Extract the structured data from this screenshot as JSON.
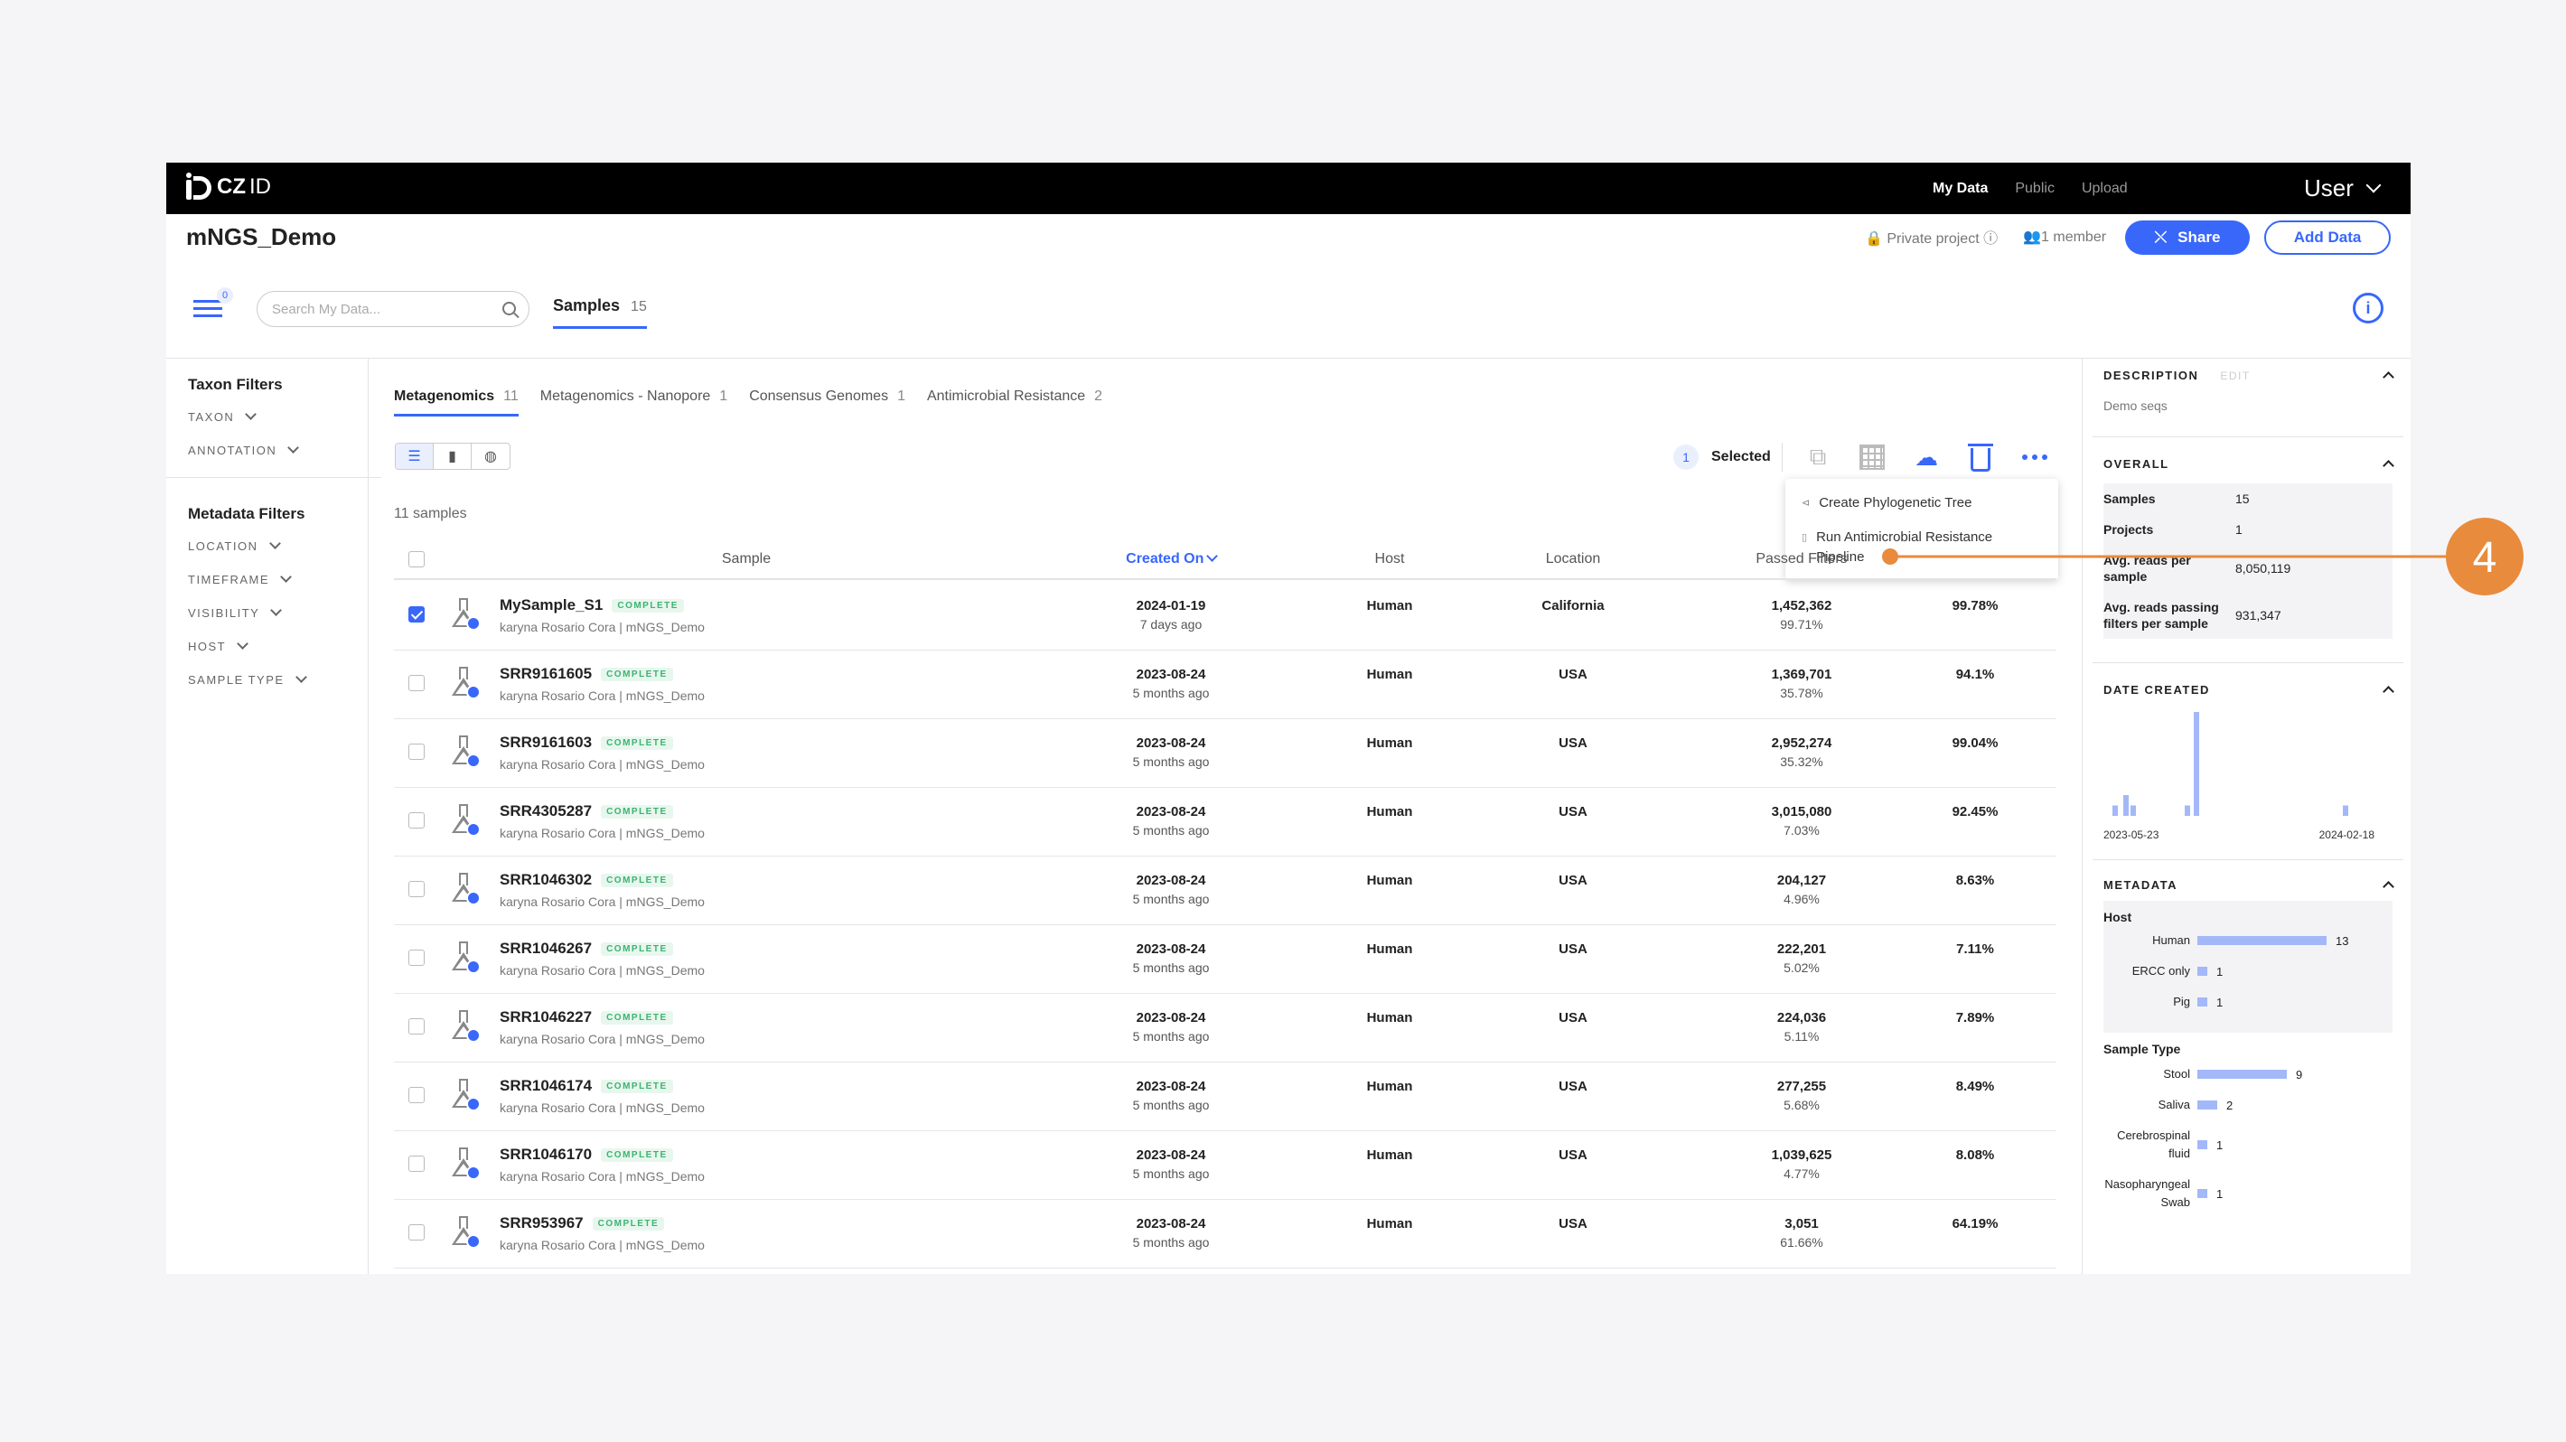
{
  "nav": {
    "brand": "CZ",
    "brand_suffix": "ID",
    "links": [
      "My Data",
      "Public",
      "Upload"
    ],
    "user": "User"
  },
  "project": {
    "title": "mNGS_Demo",
    "privacy": "Private project",
    "members": "1 member",
    "share_label": "Share",
    "add_data_label": "Add Data"
  },
  "toolbar": {
    "filter_badge": "0",
    "search_placeholder": "Search My Data...",
    "samples_tab": "Samples",
    "samples_count": "15"
  },
  "filters": {
    "taxon_title": "Taxon Filters",
    "taxon_items": [
      "TAXON",
      "ANNOTATION"
    ],
    "metadata_title": "Metadata Filters",
    "metadata_items": [
      "LOCATION",
      "TIMEFRAME",
      "VISIBILITY",
      "HOST",
      "SAMPLE TYPE"
    ]
  },
  "workflow_tabs": [
    {
      "label": "Metagenomics",
      "count": "11"
    },
    {
      "label": "Metagenomics - Nanopore",
      "count": "1"
    },
    {
      "label": "Consensus Genomes",
      "count": "1"
    },
    {
      "label": "Antimicrobial Resistance",
      "count": "2"
    }
  ],
  "selection": {
    "count": "1",
    "label": "Selected"
  },
  "dropdown": {
    "opt1": "Create Phylogenetic Tree",
    "opt2_line1": "Run Antimicrobial Resistance",
    "opt2_line2": "Pipeline"
  },
  "sample_count_text": "11 samples",
  "table": {
    "headers": [
      "Sample",
      "Created On",
      "Host",
      "Location",
      "Passed Filters"
    ],
    "status": "COMPLETE",
    "rows": [
      {
        "name": "MySample_S1",
        "sub": "karyna Rosario Cora | mNGS_Demo",
        "date": "2024-01-19",
        "ago": "7 days ago",
        "host": "Human",
        "loc": "California",
        "reads": "1,452,362",
        "pct": "99.71%",
        "last": "99.78%"
      },
      {
        "name": "SRR9161605",
        "sub": "karyna Rosario Cora | mNGS_Demo",
        "date": "2023-08-24",
        "ago": "5 months ago",
        "host": "Human",
        "loc": "USA",
        "reads": "1,369,701",
        "pct": "35.78%",
        "last": "94.1%"
      },
      {
        "name": "SRR9161603",
        "sub": "karyna Rosario Cora | mNGS_Demo",
        "date": "2023-08-24",
        "ago": "5 months ago",
        "host": "Human",
        "loc": "USA",
        "reads": "2,952,274",
        "pct": "35.32%",
        "last": "99.04%"
      },
      {
        "name": "SRR4305287",
        "sub": "karyna Rosario Cora | mNGS_Demo",
        "date": "2023-08-24",
        "ago": "5 months ago",
        "host": "Human",
        "loc": "USA",
        "reads": "3,015,080",
        "pct": "7.03%",
        "last": "92.45%"
      },
      {
        "name": "SRR1046302",
        "sub": "karyna Rosario Cora | mNGS_Demo",
        "date": "2023-08-24",
        "ago": "5 months ago",
        "host": "Human",
        "loc": "USA",
        "reads": "204,127",
        "pct": "4.96%",
        "last": "8.63%"
      },
      {
        "name": "SRR1046267",
        "sub": "karyna Rosario Cora | mNGS_Demo",
        "date": "2023-08-24",
        "ago": "5 months ago",
        "host": "Human",
        "loc": "USA",
        "reads": "222,201",
        "pct": "5.02%",
        "last": "7.11%"
      },
      {
        "name": "SRR1046227",
        "sub": "karyna Rosario Cora | mNGS_Demo",
        "date": "2023-08-24",
        "ago": "5 months ago",
        "host": "Human",
        "loc": "USA",
        "reads": "224,036",
        "pct": "5.11%",
        "last": "7.89%"
      },
      {
        "name": "SRR1046174",
        "sub": "karyna Rosario Cora | mNGS_Demo",
        "date": "2023-08-24",
        "ago": "5 months ago",
        "host": "Human",
        "loc": "USA",
        "reads": "277,255",
        "pct": "5.68%",
        "last": "8.49%"
      },
      {
        "name": "SRR1046170",
        "sub": "karyna Rosario Cora | mNGS_Demo",
        "date": "2023-08-24",
        "ago": "5 months ago",
        "host": "Human",
        "loc": "USA",
        "reads": "1,039,625",
        "pct": "4.77%",
        "last": "8.08%"
      },
      {
        "name": "SRR953967",
        "sub": "karyna Rosario Cora | mNGS_Demo",
        "date": "2023-08-24",
        "ago": "5 months ago",
        "host": "Human",
        "loc": "USA",
        "reads": "3,051",
        "pct": "61.66%",
        "last": "64.19%"
      }
    ]
  },
  "panel": {
    "description_title": "DESCRIPTION",
    "edit": "EDIT",
    "description": "Demo seqs",
    "overall_title": "OVERALL",
    "overall": [
      {
        "k": "Samples",
        "v": "15"
      },
      {
        "k": "Projects",
        "v": "1"
      },
      {
        "k": "Avg. reads per sample",
        "v": "8,050,119"
      },
      {
        "k": "Avg. reads passing filters per sample",
        "v": "931,347"
      }
    ],
    "date_title": "DATE CREATED",
    "date_start": "2023-05-23",
    "date_end": "2024-02-18",
    "metadata_title": "METADATA",
    "host_title": "Host",
    "host": [
      {
        "label": "Human",
        "value": 13
      },
      {
        "label": "ERCC only",
        "value": 1
      },
      {
        "label": "Pig",
        "value": 1
      }
    ],
    "sample_type_title": "Sample Type",
    "sample_type": [
      {
        "label": "Stool",
        "value": 9
      },
      {
        "label": "Saliva",
        "value": 2
      },
      {
        "label": "Cerebrospinal fluid",
        "value": 1
      },
      {
        "label": "Nasopharyngeal Swab",
        "value": 1
      }
    ]
  },
  "callout": {
    "number": "4",
    "color": "#e88b3d"
  },
  "chart_data": {
    "type": "bar",
    "x": [
      "2023-05-23",
      "2023-06",
      "2023-07",
      "2023-08",
      "2023-09",
      "2024-01",
      "2024-02-18"
    ],
    "values": [
      1,
      2,
      1,
      1,
      10,
      1,
      0
    ],
    "xlabel": "",
    "ylabel": ""
  },
  "colors": {
    "accent": "#3867fa",
    "status_green": "#3cb371",
    "bar": "#a3b8f8"
  }
}
